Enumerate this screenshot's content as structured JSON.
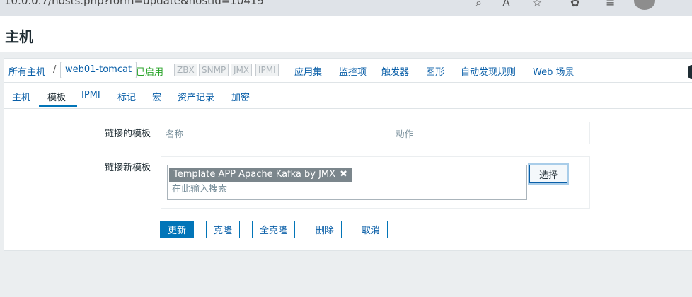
{
  "browser": {
    "url": "10.0.0.7/hosts.php?form=update&hostid=10419"
  },
  "page": {
    "title": "主机"
  },
  "breadcrumb": {
    "all_hosts": "所有主机",
    "separator": "/",
    "current_host": "web01-tomcat",
    "status": "已启用",
    "availability": [
      "ZBX",
      "SNMP",
      "JMX",
      "IPMI"
    ],
    "links": [
      "应用集",
      "监控项",
      "触发器",
      "图形",
      "自动发现规则",
      "Web 场景"
    ]
  },
  "tabs": [
    {
      "label": "主机"
    },
    {
      "label": "模板"
    },
    {
      "label": "IPMI"
    },
    {
      "label": "标记"
    },
    {
      "label": "宏"
    },
    {
      "label": "资产记录"
    },
    {
      "label": "加密"
    }
  ],
  "form": {
    "linked_templates_label": "链接的模板",
    "linked_columns": {
      "name": "名称",
      "action": "动作"
    },
    "link_new_label": "链接新模板",
    "selected_template": "Template APP Apache Kafka by JMX",
    "search_placeholder": "在此输入搜索",
    "select_button": "选择"
  },
  "actions": {
    "update": "更新",
    "clone": "克隆",
    "full_clone": "全克隆",
    "delete": "删除",
    "cancel": "取消"
  },
  "colors": {
    "link": "#0a5fa8",
    "primary": "#0275b8",
    "enabled": "#29a329",
    "chip": "#7b868c"
  }
}
